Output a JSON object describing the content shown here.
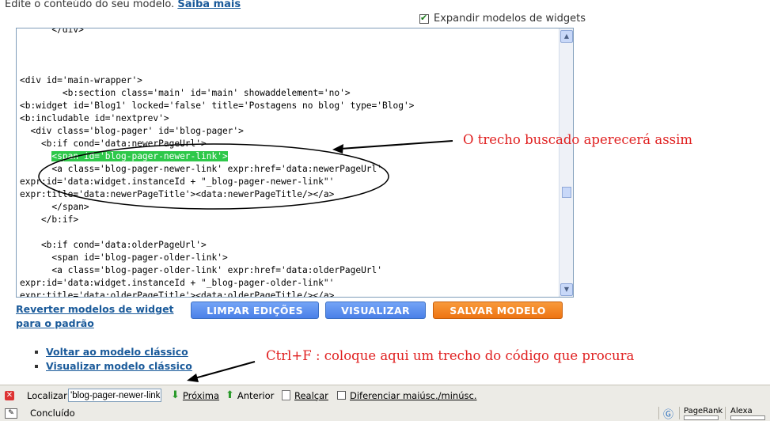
{
  "header": {
    "intro_text": "Edite o conteúdo do seu modelo.",
    "intro_link": "Saiba mais",
    "expand_label": "Expandir modelos de widgets",
    "expand_checked": true
  },
  "editor": {
    "lines": [
      "      </div>",
      "",
      "",
      "",
      "<div id='main-wrapper'>",
      "        <b:section class='main' id='main' showaddelement='no'>",
      "<b:widget id='Blog1' locked='false' title='Postagens no blog' type='Blog'>",
      "<b:includable id='nextprev'>",
      "  <div class='blog-pager' id='blog-pager'>",
      "    <b:if cond='data:newerPageUrl'>",
      "",
      "      <a class='blog-pager-newer-link' expr:href='data:newerPageUrl'",
      "expr:id='data:widget.instanceId + &quot;_blog-pager-newer-link&quot;'",
      "expr:title='data:newerPageTitle'><data:newerPageTitle/></a>",
      "      </span>",
      "    </b:if>",
      "",
      "    <b:if cond='data:olderPageUrl'>",
      "      <span id='blog-pager-older-link'>",
      "      <a class='blog-pager-older-link' expr:href='data:olderPageUrl'",
      "expr:id='data:widget.instanceId + &quot;_blog-pager-older-link&quot;'",
      "expr:title='data:olderPageTitle'><data:olderPageTitle/></a>"
    ],
    "highlight_indent": "      ",
    "highlight_text": "<span id='blog-pager-newer-link'>"
  },
  "actions": {
    "revert_label": "Reverter modelos de widget para o padrão",
    "clear_label": "LIMPAR EDIÇÕES",
    "preview_label": "VISUALIZAR",
    "save_label": "SALVAR MODELO"
  },
  "links": {
    "classic_back": "Voltar ao modelo clássico",
    "classic_view": "Visualizar modelo clássico"
  },
  "annotations": {
    "top_note": "O trecho buscado aperecerá assim",
    "bottom_note": "Ctrl+F : coloque aqui um trecho do código que procura"
  },
  "findbar": {
    "label": "Localizar:",
    "value": "'blog-pager-newer-link'>",
    "next_label": "Próxima",
    "previous_label": "Anterior",
    "highlight_label": "Realçar",
    "match_case_label": "Diferenciar maiúsc./minúsc."
  },
  "statusbar": {
    "status_text": "Concluído",
    "pagerank_label": "PageRank",
    "alexa_label": "Alexa"
  },
  "colors": {
    "highlight": "#2ec84a",
    "annotation": "#e02020",
    "button_blue": "#4a80e8",
    "button_orange": "#ee7412"
  },
  "icons": [
    "checkbox-checked-icon",
    "scroll-up-icon",
    "scroll-down-icon",
    "close-icon",
    "arrow-down-icon",
    "arrow-up-icon",
    "highlight-icon",
    "page-icon",
    "pagerank-icon",
    "alexa-icon"
  ]
}
